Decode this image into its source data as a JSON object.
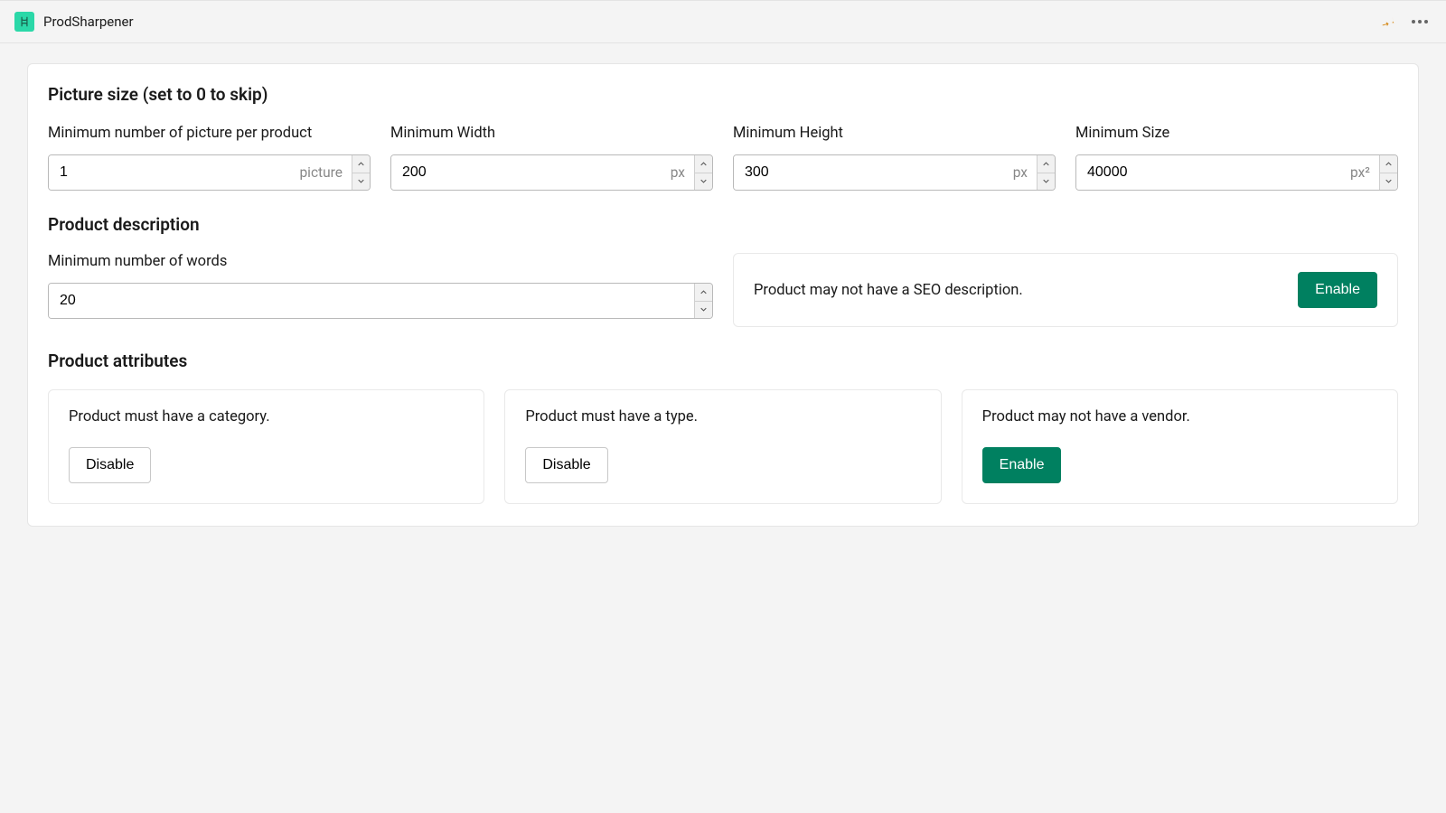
{
  "app": {
    "title": "ProdSharpener"
  },
  "sections": {
    "picture": {
      "title": "Picture size (set to 0 to skip)",
      "fields": {
        "min_pictures": {
          "label": "Minimum number of picture per product",
          "value": "1",
          "suffix": "picture"
        },
        "min_width": {
          "label": "Minimum Width",
          "value": "200",
          "suffix": "px"
        },
        "min_height": {
          "label": "Minimum Height",
          "value": "300",
          "suffix": "px"
        },
        "min_size": {
          "label": "Minimum Size",
          "value": "40000",
          "suffix": "px²"
        }
      }
    },
    "description": {
      "title": "Product description",
      "min_words": {
        "label": "Minimum number of words",
        "value": "20"
      },
      "seo": {
        "text": "Product may not have a SEO description.",
        "button": "Enable"
      }
    },
    "attributes": {
      "title": "Product attributes",
      "cards": {
        "category": {
          "text": "Product must have a category.",
          "button": "Disable"
        },
        "type": {
          "text": "Product must have a type.",
          "button": "Disable"
        },
        "vendor": {
          "text": "Product may not have a vendor.",
          "button": "Enable"
        }
      }
    }
  }
}
